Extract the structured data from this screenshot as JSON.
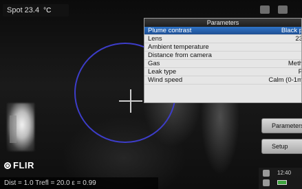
{
  "overlay": {
    "spot_label": "Spot 23.4",
    "spot_unit": "°C",
    "brand": "FLIR",
    "status_line": "Dist = 1.0  Trefl = 20.0  ε = 0.99",
    "time": "12:40"
  },
  "panel": {
    "title": "Parameters",
    "rows": [
      {
        "label": "Plume contrast",
        "value": "Black p",
        "selected": true
      },
      {
        "label": "Lens",
        "value": "23",
        "selected": false
      },
      {
        "label": "Ambient temperature",
        "value": "",
        "selected": false
      },
      {
        "label": "Distance from camera",
        "value": "",
        "selected": false
      },
      {
        "label": "Gas",
        "value": "Meth",
        "selected": false
      },
      {
        "label": "Leak type",
        "value": "P",
        "selected": false
      },
      {
        "label": "Wind speed",
        "value": "Calm (0-1m",
        "selected": false
      }
    ]
  },
  "buttons": {
    "parameters": "Parameters",
    "setup": "Setup"
  },
  "icons": {
    "top_right_1": "settings-icon",
    "top_right_2": "menu-icon",
    "bottom_1": "camera-icon",
    "bottom_2": "storage-icon"
  },
  "colors": {
    "selection": "#1e4e93",
    "circle": "#3d3dc9"
  }
}
